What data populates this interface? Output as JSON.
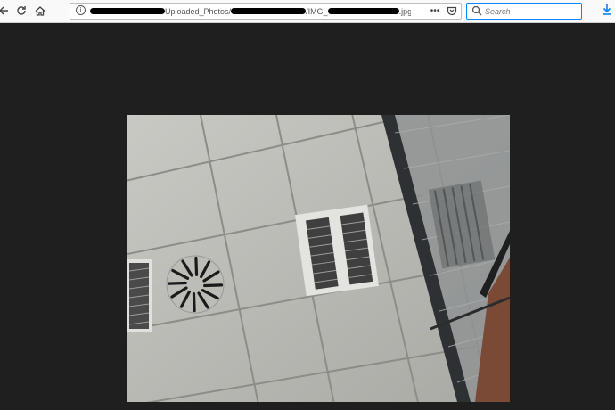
{
  "browser": {
    "nav": {
      "back_icon": "arrow-left-icon",
      "reload_icon": "reload-icon",
      "home_icon": "home-icon"
    },
    "address_bar": {
      "info_icon": "info-icon",
      "url_text_1": "Uploaded_Photos/",
      "url_text_2": "/IMG_",
      "url_text_3": ".jpg",
      "more_icon": "ellipsis-icon",
      "pocket_icon": "pocket-icon"
    },
    "search": {
      "placeholder": "Search",
      "icon": "search-icon"
    },
    "download_icon": "download-icon",
    "accent_color": "#0a84ff"
  },
  "viewer": {
    "background_color": "#1f1f1f",
    "image_subject": "ceiling-photo"
  }
}
